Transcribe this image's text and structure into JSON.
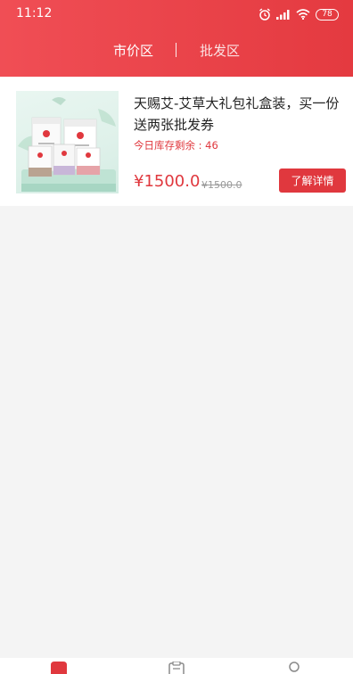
{
  "status_bar": {
    "time": "11:12",
    "battery": "78",
    "icons": [
      "alarm-icon",
      "signal-icon",
      "wifi-icon",
      "battery-icon"
    ]
  },
  "tabs": [
    {
      "label": "市价区",
      "active": true
    },
    {
      "label": "批发区",
      "active": false
    }
  ],
  "product": {
    "title": "天赐艾-艾草大礼包礼盒装，买一份送两张批发券",
    "stock": "今日库存剩余 : 46",
    "price": "¥1500.0",
    "original_price": "¥1500.0",
    "detail_button": "了解详情",
    "image_icon": "gift-box-product-image"
  },
  "bottom_nav": {
    "items": [
      "home-icon",
      "orders-icon",
      "profile-icon"
    ]
  },
  "colors": {
    "header_gradient_start": "#f04e55",
    "header_gradient_end": "#e43a40",
    "accent": "#e0383e",
    "background": "#f4f4f4"
  }
}
